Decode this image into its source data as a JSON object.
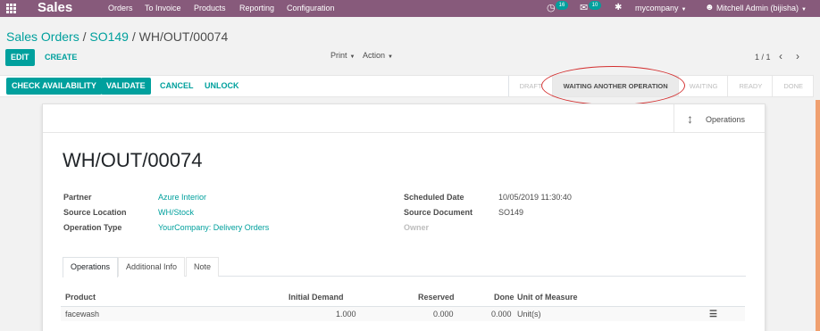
{
  "navbar": {
    "brand": "Sales",
    "menu": [
      "Orders",
      "To Invoice",
      "Products",
      "Reporting",
      "Configuration"
    ],
    "activity_count": "16",
    "message_count": "10",
    "company": "mycompany",
    "user": "Mitchell Admin (bijisha)"
  },
  "breadcrumb": {
    "root": "Sales Orders",
    "sep1": "/",
    "order": "SO149",
    "sep2": "/",
    "current": "WH/OUT/00074"
  },
  "toolbar": {
    "edit": "EDIT",
    "create": "CREATE",
    "print": "Print",
    "action": "Action",
    "pager": "1 / 1"
  },
  "header_buttons": {
    "check": "CHECK AVAILABILITY",
    "validate": "VALIDATE",
    "cancel": "CANCEL",
    "unlock": "UNLOCK"
  },
  "status_stages": [
    "DRAFT",
    "WAITING ANOTHER OPERATION",
    "WAITING",
    "READY",
    "DONE"
  ],
  "smart_button": {
    "label": "Operations"
  },
  "record": {
    "name": "WH/OUT/00074",
    "partner_label": "Partner",
    "partner": "Azure Interior",
    "source_location_label": "Source Location",
    "source_location": "WH/Stock",
    "operation_type_label": "Operation Type",
    "operation_type": "YourCompany: Delivery Orders",
    "scheduled_date_label": "Scheduled Date",
    "scheduled_date": "10/05/2019 11:30:40",
    "source_document_label": "Source Document",
    "source_document": "SO149",
    "owner_label": "Owner"
  },
  "tabs": [
    "Operations",
    "Additional Info",
    "Note"
  ],
  "table": {
    "headers": [
      "Product",
      "Initial Demand",
      "Reserved",
      "Done",
      "Unit of Measure"
    ],
    "rows": [
      {
        "product": "facewash",
        "initial_demand": "1.000",
        "reserved": "0.000",
        "done": "0.000",
        "uom": "Unit(s)"
      }
    ]
  }
}
